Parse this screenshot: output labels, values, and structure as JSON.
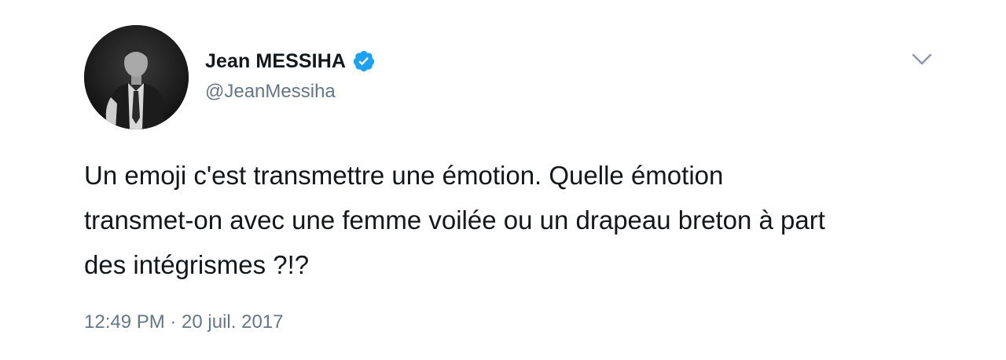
{
  "author": {
    "display_name": "Jean MESSIHA",
    "handle": "@JeanMessiha",
    "verified": true,
    "verified_color": "#1da1f2"
  },
  "tweet": {
    "text": "Un emoji c'est transmettre une émotion. Quelle émotion\ntransmet-on avec une femme voilée ou un drapeau breton à part\ndes intégrismes ?!?",
    "timestamp": "12:49 PM · 20 juil. 2017"
  },
  "icons": {
    "verified": "verified-badge-icon",
    "menu": "chevron-down-icon"
  },
  "colors": {
    "text": "#14171a",
    "secondary": "#657786",
    "background": "#ffffff"
  }
}
